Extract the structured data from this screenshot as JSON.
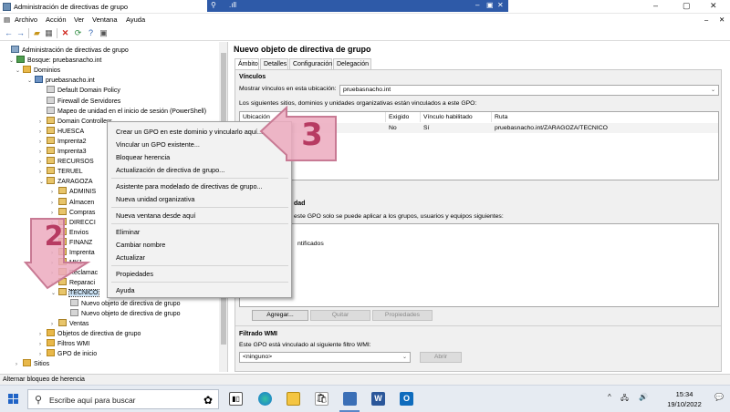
{
  "window": {
    "title": "Administración de directivas de grupo",
    "rdp_signal": ".ıll",
    "rdp_address": "",
    "controls": {
      "minimize": "–",
      "restore": "▢",
      "close": "✕"
    },
    "rdp_controls": {
      "minimize": "–",
      "restore": "▣",
      "close": "✕"
    }
  },
  "menubar": {
    "items": [
      "Archivo",
      "Acción",
      "Ver",
      "Ventana",
      "Ayuda"
    ]
  },
  "tree": {
    "items": [
      {
        "label": "Administración de directivas de grupo",
        "level": 0,
        "exp": "",
        "icon": "root"
      },
      {
        "label": "Bosque: pruebasnacho.int",
        "level": 1,
        "exp": "v",
        "icon": "forest"
      },
      {
        "label": "Dominios",
        "level": 2,
        "exp": "v",
        "icon": "folder"
      },
      {
        "label": "pruebasnacho.int",
        "level": 3,
        "exp": "v",
        "icon": "domain"
      },
      {
        "label": "Default Domain Policy",
        "level": 4,
        "exp": "",
        "icon": "gpo"
      },
      {
        "label": "Firewall de Servidores",
        "level": 4,
        "exp": "",
        "icon": "gpo"
      },
      {
        "label": "Mapeo de unidad en el inicio de sesión (PowerShell)",
        "level": 4,
        "exp": "",
        "icon": "gpo"
      },
      {
        "label": "Domain Controllers",
        "level": 4,
        "exp": ">",
        "icon": "ou"
      },
      {
        "label": "HUESCA",
        "level": 4,
        "exp": ">",
        "icon": "ou"
      },
      {
        "label": "Imprenta2",
        "level": 4,
        "exp": ">",
        "icon": "ou"
      },
      {
        "label": "Imprenta3",
        "level": 4,
        "exp": ">",
        "icon": "ou"
      },
      {
        "label": "RECURSOS",
        "level": 4,
        "exp": ">",
        "icon": "ou"
      },
      {
        "label": "TERUEL",
        "level": 4,
        "exp": ">",
        "icon": "ou"
      },
      {
        "label": "ZARAGOZA",
        "level": 4,
        "exp": "v",
        "icon": "ou"
      },
      {
        "label": "ADMINIS",
        "level": 5,
        "exp": ">",
        "icon": "ou"
      },
      {
        "label": "Almacen",
        "level": 5,
        "exp": ">",
        "icon": "ou"
      },
      {
        "label": "Compras",
        "level": 5,
        "exp": ">",
        "icon": "ou"
      },
      {
        "label": "DIRECCI",
        "level": 5,
        "exp": ">",
        "icon": "ou"
      },
      {
        "label": "Envios",
        "level": 5,
        "exp": ">",
        "icon": "ou"
      },
      {
        "label": "FINANZ",
        "level": 5,
        "exp": ">",
        "icon": "ou"
      },
      {
        "label": "Imprenta",
        "level": 5,
        "exp": ">",
        "icon": "ou"
      },
      {
        "label": "MK1",
        "level": 5,
        "exp": ">",
        "icon": "ou"
      },
      {
        "label": "Reclamac",
        "level": 5,
        "exp": ">",
        "icon": "ou"
      },
      {
        "label": "Reparaci",
        "level": 5,
        "exp": ">",
        "icon": "ou"
      },
      {
        "label": "TECNICO",
        "level": 5,
        "exp": "v",
        "icon": "ou",
        "selected": true
      },
      {
        "label": "Nuevo objeto de directiva de grupo",
        "level": 6,
        "exp": "",
        "icon": "gpo"
      },
      {
        "label": "Nuevo objeto de directiva de grupo",
        "level": 6,
        "exp": "",
        "icon": "gpo"
      },
      {
        "label": "Ventas",
        "level": 5,
        "exp": ">",
        "icon": "ou"
      },
      {
        "label": "Objetos de directiva de grupo",
        "level": 4,
        "exp": ">",
        "icon": "folder"
      },
      {
        "label": "Filtros WMI",
        "level": 4,
        "exp": ">",
        "icon": "folder"
      },
      {
        "label": "GPO de inicio",
        "level": 4,
        "exp": ">",
        "icon": "folder"
      },
      {
        "label": "Sitios",
        "level": 2,
        "exp": ">",
        "icon": "folder"
      }
    ]
  },
  "right": {
    "title": "Nuevo objeto de directiva de grupo",
    "tabs": [
      "Ámbito",
      "Detalles",
      "Configuración",
      "Delegación"
    ],
    "links": {
      "heading": "Vínculos",
      "show_label": "Mostrar vínculos en esta ubicación:",
      "location_value": "pruebasnacho.int",
      "desc": "Los siguientes sitios, dominios y unidades organizativas están vinculados a este GPO:",
      "columns": [
        "Ubicación",
        "Exigido",
        "Vínculo habilitado",
        "Ruta"
      ],
      "row": {
        "location": "",
        "enforced": "No",
        "enabled": "Sí",
        "path": "pruebasnacho.int/ZARAGOZA/TECNICO"
      }
    },
    "security": {
      "heading_partial": "dad",
      "desc_partial": "este GPO solo se puede aplicar a los grupos, usuarios y equipos siguientes:",
      "entry_partial": "ntificados"
    },
    "buttons": {
      "add": "Agregar...",
      "remove": "Quitar",
      "properties": "Propiedades"
    },
    "wmi": {
      "heading": "Filtrado WMI",
      "desc": "Este GPO está vinculado al siguiente filtro WMI:",
      "value": "<ninguno>",
      "open": "Abrir"
    }
  },
  "context_menu": {
    "items": [
      "Crear un GPO en este dominio y vincularlo aquí...",
      "Vincular un GPO existente...",
      "Bloquear herencia",
      "Actualización de directiva de grupo...",
      "Asistente para modelado de directivas de grupo...",
      "Nueva unidad organizativa",
      "Nueva ventana desde aquí",
      "Eliminar",
      "Cambiar nombre",
      "Actualizar",
      "Propiedades",
      "Ayuda"
    ]
  },
  "callouts": {
    "step2": "2",
    "step3": "3"
  },
  "statusbar": {
    "text": "Alternar bloqueo de herencia"
  },
  "taskbar": {
    "search_placeholder": "Escribe aquí para buscar",
    "time": "15:34",
    "date": "19/10/2022",
    "tray_chevron": "^",
    "tray_network": "🖧",
    "tray_volume": "🔊",
    "tray_chat": "💬"
  },
  "colors": {
    "rdp_bar": "#2e5aa8",
    "callout_fill": "#ecaabe",
    "callout_text": "#b73b62",
    "selection": "#cce4f7"
  }
}
